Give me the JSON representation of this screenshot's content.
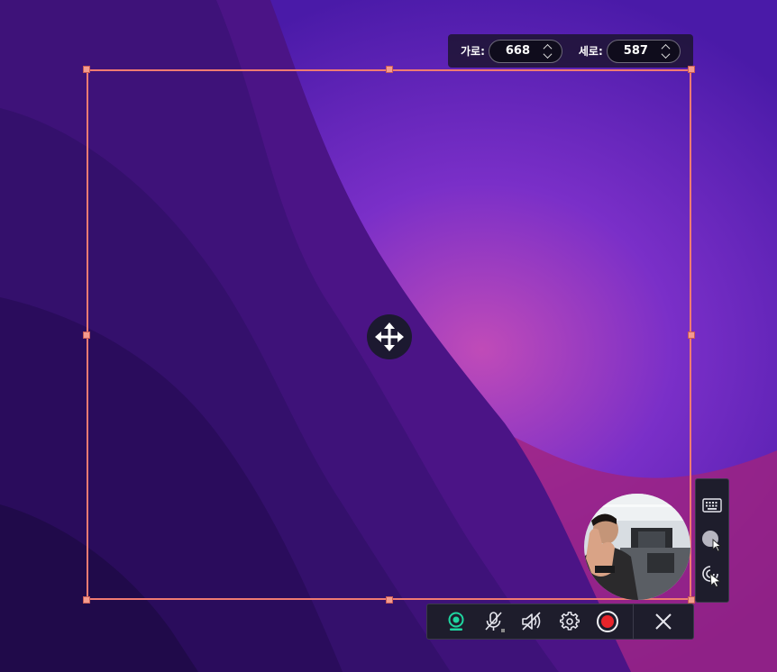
{
  "size_panel": {
    "width_label": "가로:",
    "width_value": "668",
    "height_label": "세로:",
    "height_value": "587"
  },
  "colors": {
    "frame": "#f07b72",
    "record": "#e8242b",
    "webcam_active": "#1fd6a0",
    "toolbar_bg": "#1e1d2c"
  },
  "icons": {
    "move": "move-arrows-icon",
    "webcam": "webcam-icon",
    "mic": "mic-muted-icon",
    "speaker": "speaker-muted-icon",
    "settings": "gear-icon",
    "record": "record-icon",
    "close": "close-icon",
    "keyboard": "keyboard-icon",
    "cursor_highlight": "cursor-highlight-icon",
    "click_effect": "click-effect-icon"
  }
}
